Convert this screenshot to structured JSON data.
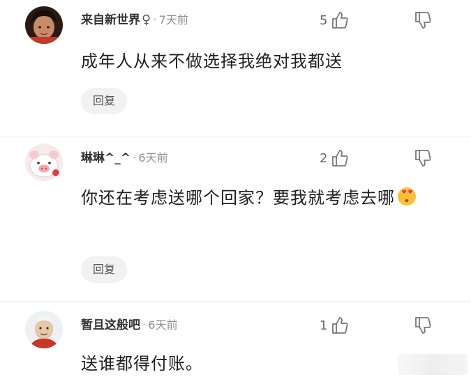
{
  "comments": [
    {
      "username": "来自新世界",
      "gender_symbol": "♀",
      "dot": "·",
      "time": "7天前",
      "likes": "5",
      "text": "成年人从来不做选择我绝对我都送",
      "reply_label": "回复",
      "avatar_icon": "user-avatar-photo"
    },
    {
      "username": "琳琳^_^",
      "dot": "·",
      "time": "6天前",
      "likes": "2",
      "text": "你还在考虑送哪个回家？要我就考虑去哪",
      "emoji_icon": "heart-eyes-kiss-emoji",
      "reply_label": "回复",
      "avatar_icon": "pig-avatar"
    },
    {
      "username": "暂且这般吧",
      "dot": "·",
      "time": "6天前",
      "likes": "1",
      "text": "送谁都得付账。",
      "avatar_icon": "elder-avatar"
    }
  ],
  "colors": {
    "text": "#1f1f1f",
    "meta": "#8f8f8f",
    "reply_bg": "#f2f2f2"
  }
}
